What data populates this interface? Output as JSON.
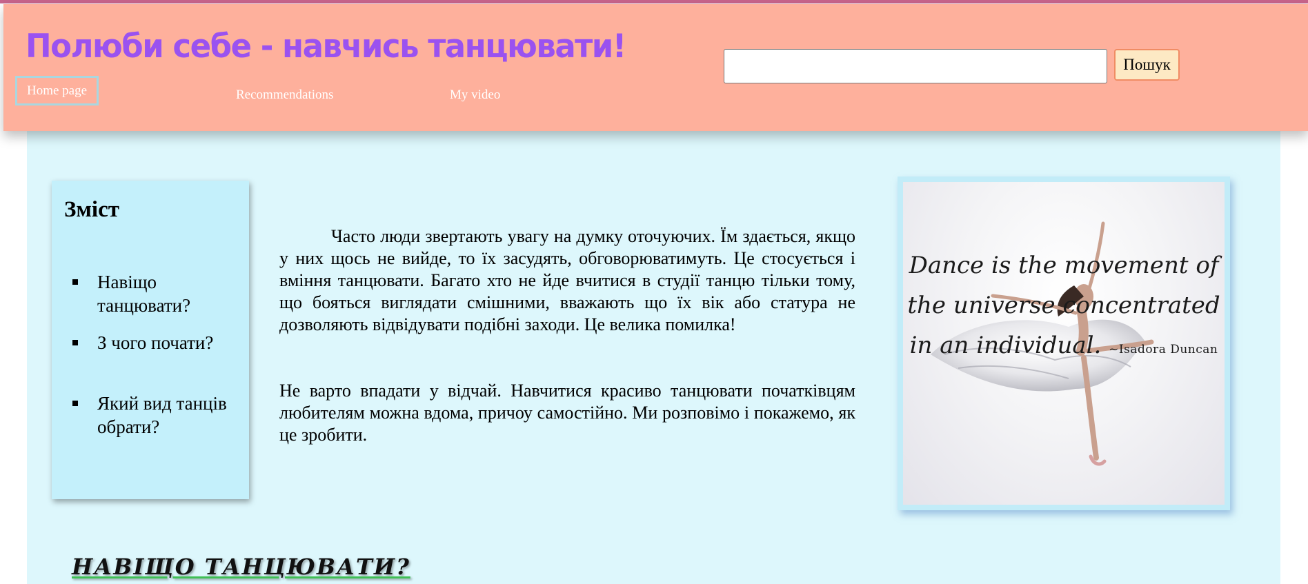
{
  "colors": {
    "header_bg": "#feb09c",
    "title": "#9a52f0",
    "main_bg": "#ddf7fc",
    "toc_bg": "#c4f0fb",
    "search_button_bg": "#fde9c4",
    "heading_underline": "#3fbf55"
  },
  "header": {
    "title": "Полюби себе - навчись танцювати!",
    "nav": {
      "home": "Home page",
      "recommendations": "Recommendations",
      "video": "My video"
    },
    "search": {
      "value": "",
      "placeholder": "",
      "button_label": "Пошук"
    }
  },
  "toc": {
    "title": "Зміст",
    "items": [
      "Навіщо танцювати?",
      "З чого почати?",
      "Який вид танців обрати?"
    ]
  },
  "content": {
    "paragraph1": "Часто люди звертають увагу на думку оточуючих. Їм здається, якщо у них щось не вийде, то їх засудять, обговорюватимуть. Це стосується і вміння танцювати. Багато хто не йде вчитися в студії танцю тільки тому, що бояться виглядати смішними, вважають що їх вік або статура не дозволяють відвідувати подібні заходи. Це велика помилка!",
    "paragraph2": "Не варто впадати у відчай. Навчитися красиво танцювати початківцям любителям можна вдома, причоу самостійно. Ми розповімо і покажемо, як це зробити."
  },
  "image": {
    "quote": "Dance is the movement of the universe concentrated in an individual.",
    "attribution": "~Isadora Duncan"
  },
  "section": {
    "heading": "НАВІЩО ТАНЦЮВАТИ?"
  }
}
